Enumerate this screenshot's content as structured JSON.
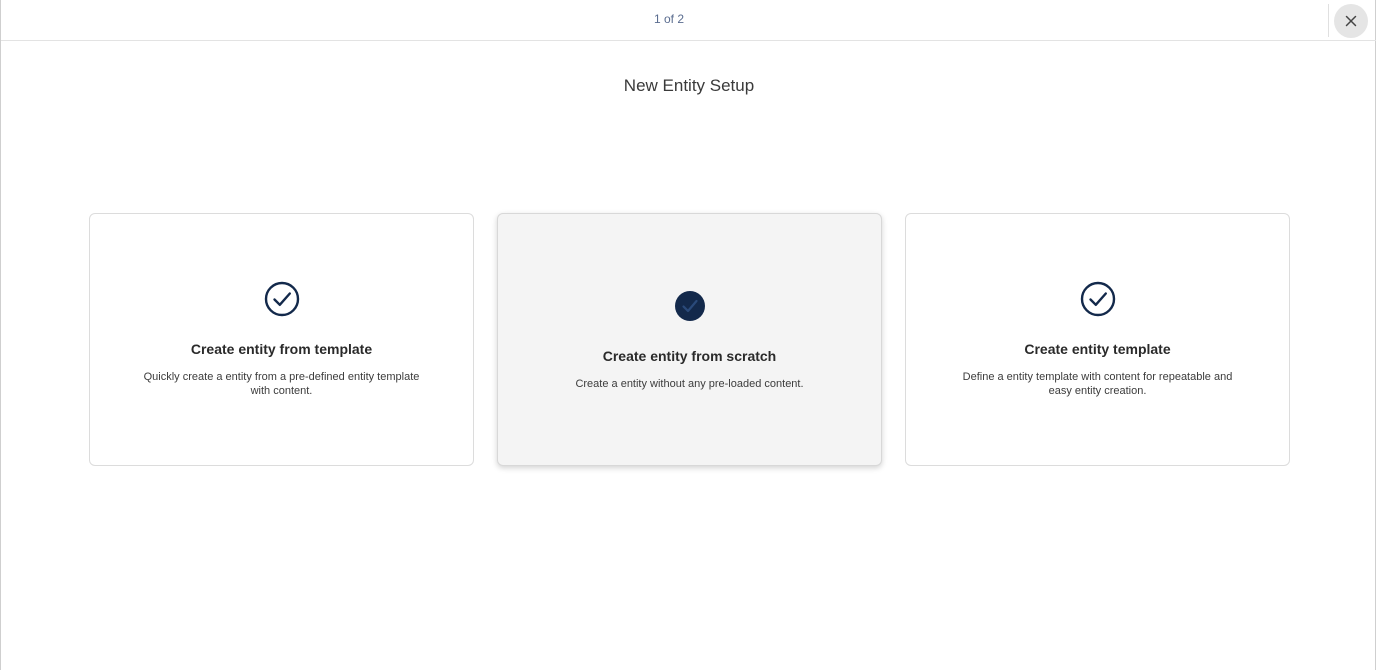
{
  "header": {
    "step_indicator": "1 of 2"
  },
  "page": {
    "title": "New Entity Setup"
  },
  "colors": {
    "icon_navy": "#13294b",
    "selected_card_bg": "#f4f4f4"
  },
  "cards": [
    {
      "title": "Create entity from template",
      "description": "Quickly create a entity from a pre-defined entity template with content.",
      "icon": "check-circle-outline-icon",
      "selected": false
    },
    {
      "title": "Create entity from scratch",
      "description": "Create a entity without any pre-loaded content.",
      "icon": "check-circle-filled-icon",
      "selected": true
    },
    {
      "title": "Create entity template",
      "description": "Define a entity template with content for repeatable and easy entity creation.",
      "icon": "check-circle-outline-icon",
      "selected": false
    }
  ]
}
